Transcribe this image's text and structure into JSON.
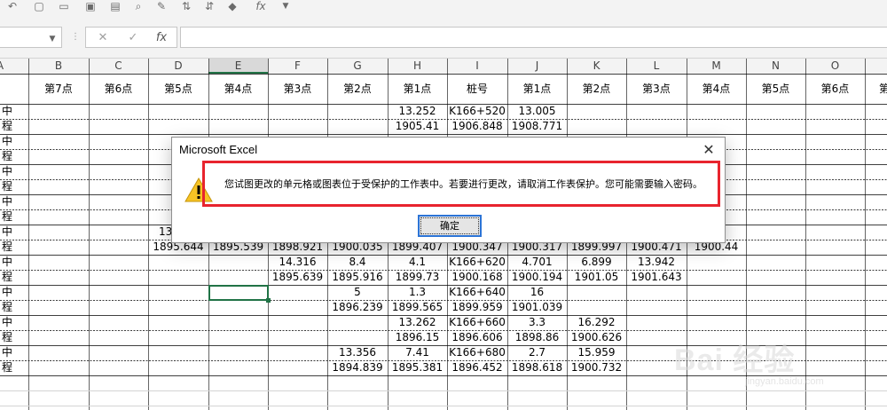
{
  "qat": {
    "icons": [
      "undo-icon",
      "new-icon",
      "open-icon",
      "save-icon",
      "print-icon",
      "print-preview-icon",
      "format-painter-icon",
      "sort-asc-icon",
      "sort-desc-icon",
      "paint-bucket-icon",
      "function-icon",
      "more-icon"
    ],
    "fx_label": "fx"
  },
  "formula_bar": {
    "name_box_value": "",
    "cancel_glyph": "✕",
    "enter_glyph": "✓",
    "fx_label": "fx",
    "formula_value": ""
  },
  "columns": [
    "A",
    "B",
    "C",
    "D",
    "E",
    "F",
    "G",
    "H",
    "I",
    "J",
    "K",
    "L",
    "M",
    "N",
    "O",
    "P"
  ],
  "header_row": [
    "",
    "第7点",
    "第6点",
    "第5点",
    "第4点",
    "第3点",
    "第2点",
    "第1点",
    "桩号",
    "第1点",
    "第2点",
    "第3点",
    "第4点",
    "第5点",
    "第6点",
    "第"
  ],
  "rows": [
    [
      "中",
      "",
      "",
      "",
      "",
      "",
      "",
      "13.252",
      "K166+520",
      "13.005",
      "",
      "",
      "",
      "",
      "",
      ""
    ],
    [
      "程",
      "",
      "",
      "",
      "",
      "",
      "",
      "1905.41",
      "1906.848",
      "1908.771",
      "",
      "",
      "",
      "",
      "",
      ""
    ],
    [
      "中",
      "",
      "",
      "",
      "",
      "",
      "",
      "",
      "",
      "",
      "",
      "",
      "",
      "",
      "",
      ""
    ],
    [
      "程",
      "",
      "",
      "",
      "",
      "",
      "",
      "",
      "",
      "",
      "",
      "",
      "",
      "",
      "",
      ""
    ],
    [
      "中",
      "",
      "",
      "",
      "",
      "",
      "",
      "",
      "",
      "",
      "",
      "",
      "",
      "",
      "",
      ""
    ],
    [
      "程",
      "",
      "",
      "",
      "",
      "",
      "",
      "",
      "",
      "",
      "",
      "",
      "",
      "",
      "",
      ""
    ],
    [
      "中",
      "",
      "",
      "",
      "",
      "",
      "",
      "",
      "",
      "",
      "",
      "",
      "",
      "",
      "",
      ""
    ],
    [
      "程",
      "",
      "",
      "",
      "",
      "",
      "",
      "",
      "",
      "",
      "",
      "",
      "",
      "",
      "",
      ""
    ],
    [
      "中",
      "",
      "",
      "13",
      "",
      "",
      "",
      "",
      "",
      "",
      "",
      "",
      "",
      "",
      "",
      ""
    ],
    [
      "程",
      "",
      "",
      "1895.644",
      "1895.539",
      "1898.921",
      "1900.035",
      "1899.407",
      "1900.347",
      "1900.317",
      "1899.997",
      "1900.471",
      "1900.44",
      "",
      "",
      ""
    ],
    [
      "中",
      "",
      "",
      "",
      "",
      "14.316",
      "8.4",
      "4.1",
      "K166+620",
      "4.701",
      "6.899",
      "13.942",
      "",
      "",
      "",
      ""
    ],
    [
      "程",
      "",
      "",
      "",
      "",
      "1895.639",
      "1895.916",
      "1899.73",
      "1900.168",
      "1900.194",
      "1901.05",
      "1901.643",
      "",
      "",
      "",
      ""
    ],
    [
      "中",
      "",
      "",
      "",
      "",
      "",
      "5",
      "1.3",
      "K166+640",
      "16",
      "",
      "",
      "",
      "",
      "",
      ""
    ],
    [
      "程",
      "",
      "",
      "",
      "",
      "",
      "1896.239",
      "1899.565",
      "1899.959",
      "1901.039",
      "",
      "",
      "",
      "",
      "",
      ""
    ],
    [
      "中",
      "",
      "",
      "",
      "",
      "",
      "",
      "13.262",
      "K166+660",
      "3.3",
      "16.292",
      "",
      "",
      "",
      "",
      ""
    ],
    [
      "程",
      "",
      "",
      "",
      "",
      "",
      "",
      "1896.15",
      "1896.606",
      "1898.86",
      "1900.626",
      "",
      "",
      "",
      "",
      ""
    ],
    [
      "中",
      "",
      "",
      "",
      "",
      "",
      "13.356",
      "7.41",
      "K166+680",
      "2.7",
      "15.959",
      "",
      "",
      "",
      "",
      ""
    ],
    [
      "程",
      "",
      "",
      "",
      "",
      "",
      "1894.839",
      "1895.381",
      "1896.452",
      "1898.618",
      "1900.732",
      "",
      "",
      "",
      "",
      ""
    ]
  ],
  "dialog": {
    "title": "Microsoft Excel",
    "close_glyph": "✕",
    "message": "您试图更改的单元格或图表位于受保护的工作表中。若要进行更改，请取消工作表保护。您可能需要输入密码。",
    "ok_label": "确定",
    "icon": "warning-icon",
    "highlight_color": "#e8242e",
    "button_focus_color": "#2c74d6"
  },
  "watermark": {
    "main": "Bai 经验",
    "sub": "jingyan.baidu.com"
  },
  "colors": {
    "selected_col_header": "#d9d9d9",
    "selected_cell_border": "#217346",
    "gridline": "#d4d4d4"
  }
}
